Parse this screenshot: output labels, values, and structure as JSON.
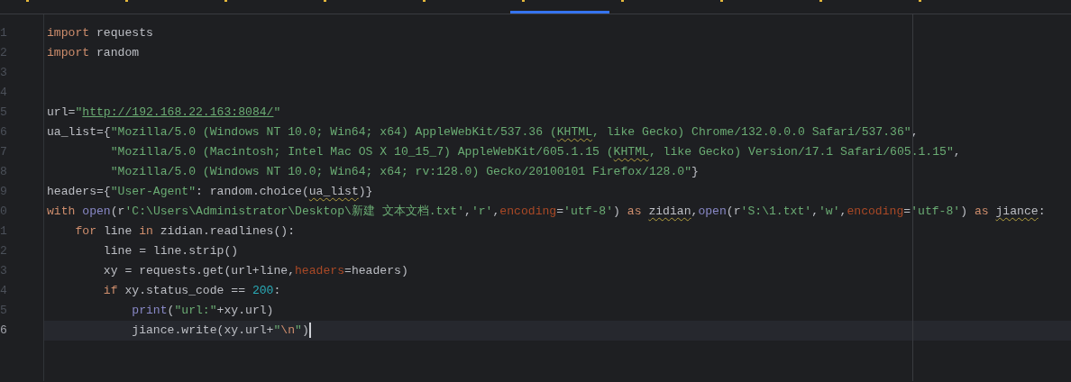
{
  "tabs": [
    {
      "selected": false
    },
    {
      "selected": false
    },
    {
      "selected": false
    },
    {
      "selected": false
    },
    {
      "selected": false
    },
    {
      "selected": true
    },
    {
      "selected": false
    },
    {
      "selected": false
    },
    {
      "selected": false
    },
    {
      "selected": false
    }
  ],
  "editor": {
    "lines": [
      {
        "number": "1",
        "current": false,
        "tokens": [
          {
            "text": "import",
            "kind": "kw"
          },
          {
            "text": " requests",
            "kind": "plain"
          }
        ]
      },
      {
        "number": "2",
        "current": false,
        "tokens": [
          {
            "text": "import",
            "kind": "kw"
          },
          {
            "text": " random",
            "kind": "plain"
          }
        ]
      },
      {
        "number": "3",
        "current": false
      },
      {
        "number": "4",
        "current": false
      },
      {
        "number": "5",
        "current": false,
        "tokens": [
          {
            "text": "url=",
            "kind": "plain"
          },
          {
            "text": "\"",
            "kind": "str"
          },
          {
            "text": "http://192.168.22.163:8084/",
            "kind": "link"
          },
          {
            "text": "\"",
            "kind": "str"
          }
        ]
      },
      {
        "number": "6",
        "current": false,
        "tokens": [
          {
            "text": "ua_list={",
            "kind": "plain"
          },
          {
            "text": "\"Mozilla/5.0 (Windows NT 10.0; Win64; x64) AppleWebKit/537.36 (",
            "kind": "str"
          },
          {
            "text": "KHTML",
            "kind": "str",
            "typo": true
          },
          {
            "text": ", like Gecko) Chrome/132.0.0.0 Safari/537.36\"",
            "kind": "str"
          },
          {
            "text": ",",
            "kind": "plain"
          }
        ]
      },
      {
        "number": "7",
        "current": false,
        "tokens": [
          {
            "text": "         \"Mozilla/5.0 (Macintosh; Intel Mac OS X 10_15_7) AppleWebKit/605.1.15 (",
            "kind": "str"
          },
          {
            "text": "KHTML",
            "kind": "str",
            "typo": true
          },
          {
            "text": ", like Gecko) Version/17.1 Safari/605.1.15\"",
            "kind": "str"
          },
          {
            "text": ",",
            "kind": "plain"
          }
        ]
      },
      {
        "number": "8",
        "current": false,
        "tokens": [
          {
            "text": "         \"Mozilla/5.0 (Windows NT 10.0; Win64; x64; rv:128.0) Gecko/20100101 Firefox/128.0\"",
            "kind": "str"
          },
          {
            "text": "}",
            "kind": "plain"
          }
        ]
      },
      {
        "number": "9",
        "current": false,
        "tokens": [
          {
            "text": "headers={",
            "kind": "plain"
          },
          {
            "text": "\"User-Agent\"",
            "kind": "str"
          },
          {
            "text": ": random.choice(",
            "kind": "plain"
          },
          {
            "text": "ua_list",
            "kind": "plain",
            "typo": true
          },
          {
            "text": ")}",
            "kind": "plain"
          }
        ]
      },
      {
        "number": "0",
        "current": false,
        "tokens": [
          {
            "text": "with ",
            "kind": "kw"
          },
          {
            "text": "open",
            "kind": "builtin"
          },
          {
            "text": "(r",
            "kind": "plain"
          },
          {
            "text": "'C:\\Users\\Administrator\\Desktop\\新建 文本文档.txt'",
            "kind": "str"
          },
          {
            "text": ",",
            "kind": "plain"
          },
          {
            "text": "'r'",
            "kind": "str"
          },
          {
            "text": ",",
            "kind": "plain"
          },
          {
            "text": "encoding",
            "kind": "param"
          },
          {
            "text": "=",
            "kind": "plain"
          },
          {
            "text": "'utf-8'",
            "kind": "str"
          },
          {
            "text": ") ",
            "kind": "plain"
          },
          {
            "text": "as ",
            "kind": "kw"
          },
          {
            "text": "zidian",
            "kind": "plain",
            "typo": true
          },
          {
            "text": ",",
            "kind": "plain"
          },
          {
            "text": "open",
            "kind": "builtin"
          },
          {
            "text": "(r",
            "kind": "plain"
          },
          {
            "text": "'S:\\1.txt'",
            "kind": "str"
          },
          {
            "text": ",",
            "kind": "plain"
          },
          {
            "text": "'w'",
            "kind": "str"
          },
          {
            "text": ",",
            "kind": "plain"
          },
          {
            "text": "encoding",
            "kind": "param"
          },
          {
            "text": "=",
            "kind": "plain"
          },
          {
            "text": "'utf-8'",
            "kind": "str"
          },
          {
            "text": ") ",
            "kind": "plain"
          },
          {
            "text": "as ",
            "kind": "kw"
          },
          {
            "text": "jiance",
            "kind": "plain",
            "typo": true
          },
          {
            "text": ":",
            "kind": "plain"
          }
        ]
      },
      {
        "number": "1",
        "current": false,
        "tokens": [
          {
            "text": "    for ",
            "kind": "kw"
          },
          {
            "text": "line ",
            "kind": "plain"
          },
          {
            "text": "in ",
            "kind": "kw"
          },
          {
            "text": "zidian.readlines():",
            "kind": "plain"
          }
        ]
      },
      {
        "number": "2",
        "current": false,
        "tokens": [
          {
            "text": "        line = line.strip()",
            "kind": "plain"
          }
        ]
      },
      {
        "number": "3",
        "current": false,
        "tokens": [
          {
            "text": "        xy = requests.get(url+line,",
            "kind": "plain"
          },
          {
            "text": "headers",
            "kind": "param"
          },
          {
            "text": "=headers)",
            "kind": "plain"
          }
        ]
      },
      {
        "number": "4",
        "current": false,
        "tokens": [
          {
            "text": "        if ",
            "kind": "kw"
          },
          {
            "text": "xy.status_code == ",
            "kind": "plain"
          },
          {
            "text": "200",
            "kind": "num"
          },
          {
            "text": ":",
            "kind": "plain"
          }
        ]
      },
      {
        "number": "5",
        "current": false,
        "tokens": [
          {
            "text": "            print",
            "kind": "builtin"
          },
          {
            "text": "(",
            "kind": "plain"
          },
          {
            "text": "\"url:\"",
            "kind": "str"
          },
          {
            "text": "+xy.url)",
            "kind": "plain"
          }
        ]
      },
      {
        "number": "6",
        "current": true,
        "tokens": [
          {
            "text": "            jiance.write(xy.url+",
            "kind": "plain"
          },
          {
            "text": "\"",
            "kind": "str"
          },
          {
            "text": "\\n",
            "kind": "esc"
          },
          {
            "text": "\"",
            "kind": "str"
          },
          {
            "text": ")",
            "kind": "plain"
          }
        ]
      }
    ]
  }
}
